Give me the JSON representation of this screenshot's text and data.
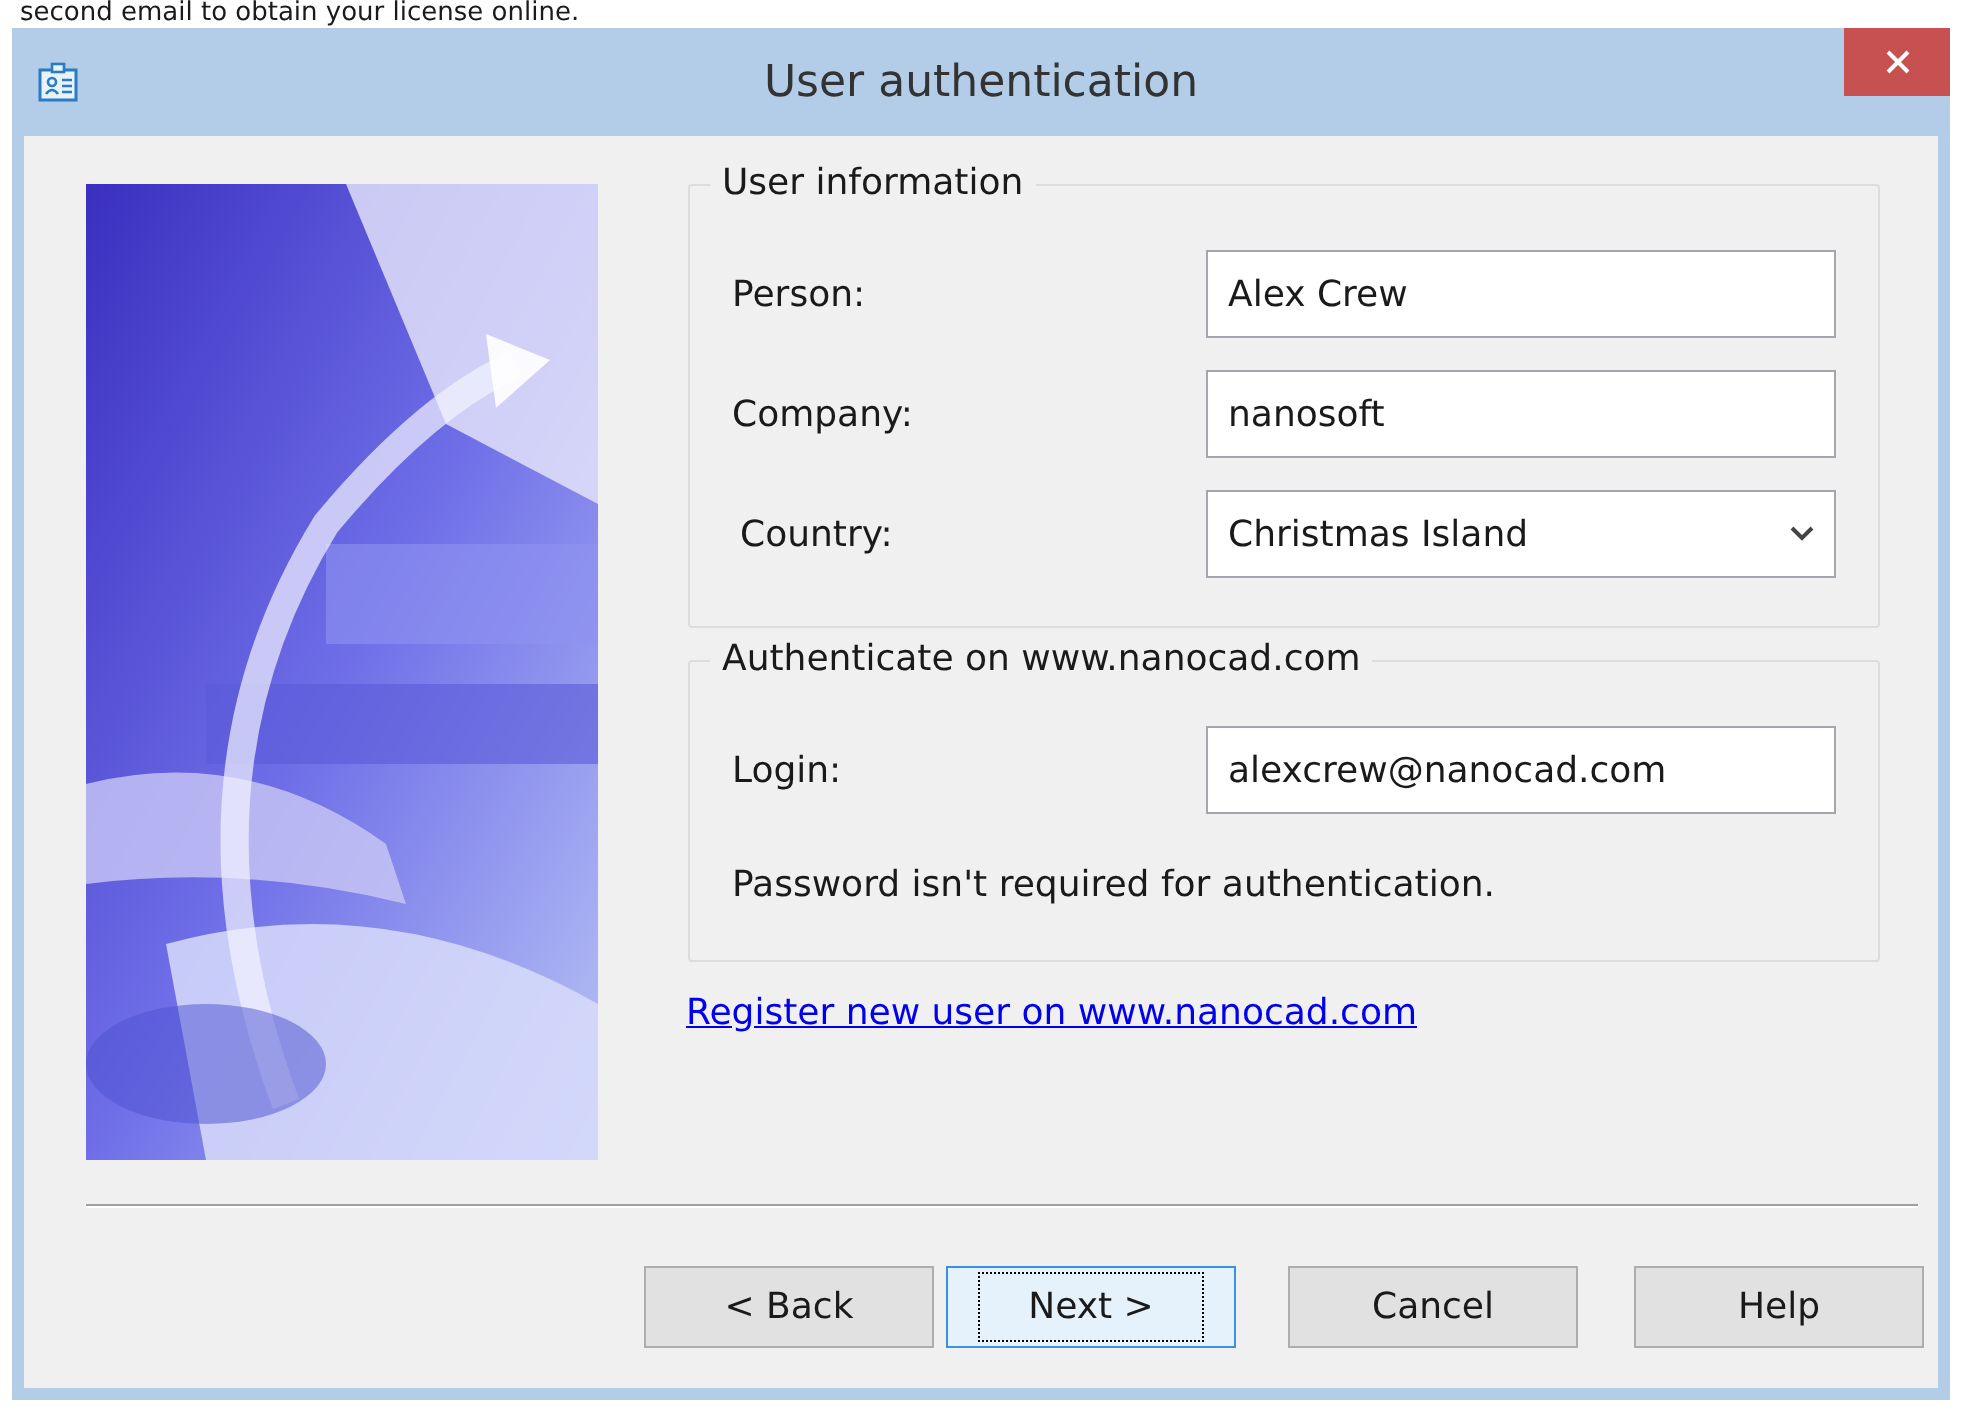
{
  "background_text": "second email to obtain your license online.",
  "window": {
    "title": "User authentication"
  },
  "groups": [
    {
      "title": "User information",
      "fields": [
        {
          "kind": "text",
          "label": "Person:",
          "value": "Alex Crew"
        },
        {
          "kind": "text",
          "label": "Company:",
          "value": "nanosoft"
        },
        {
          "kind": "dropdown",
          "label": "Country:",
          "value": "Christmas Island"
        }
      ]
    },
    {
      "title": "Authenticate on www.nanocad.com",
      "fields": [
        {
          "kind": "text",
          "label": "Login:",
          "value": "alexcrew@nanocad.com"
        }
      ],
      "note": "Password isn't required for authentication."
    }
  ],
  "link": "Register new user on www.nanocad.com",
  "buttons": [
    {
      "label": "< Back",
      "selected": false
    },
    {
      "label": "Next >",
      "selected": true
    },
    {
      "label": "Cancel",
      "selected": false
    },
    {
      "label": "Help",
      "selected": false
    }
  ]
}
